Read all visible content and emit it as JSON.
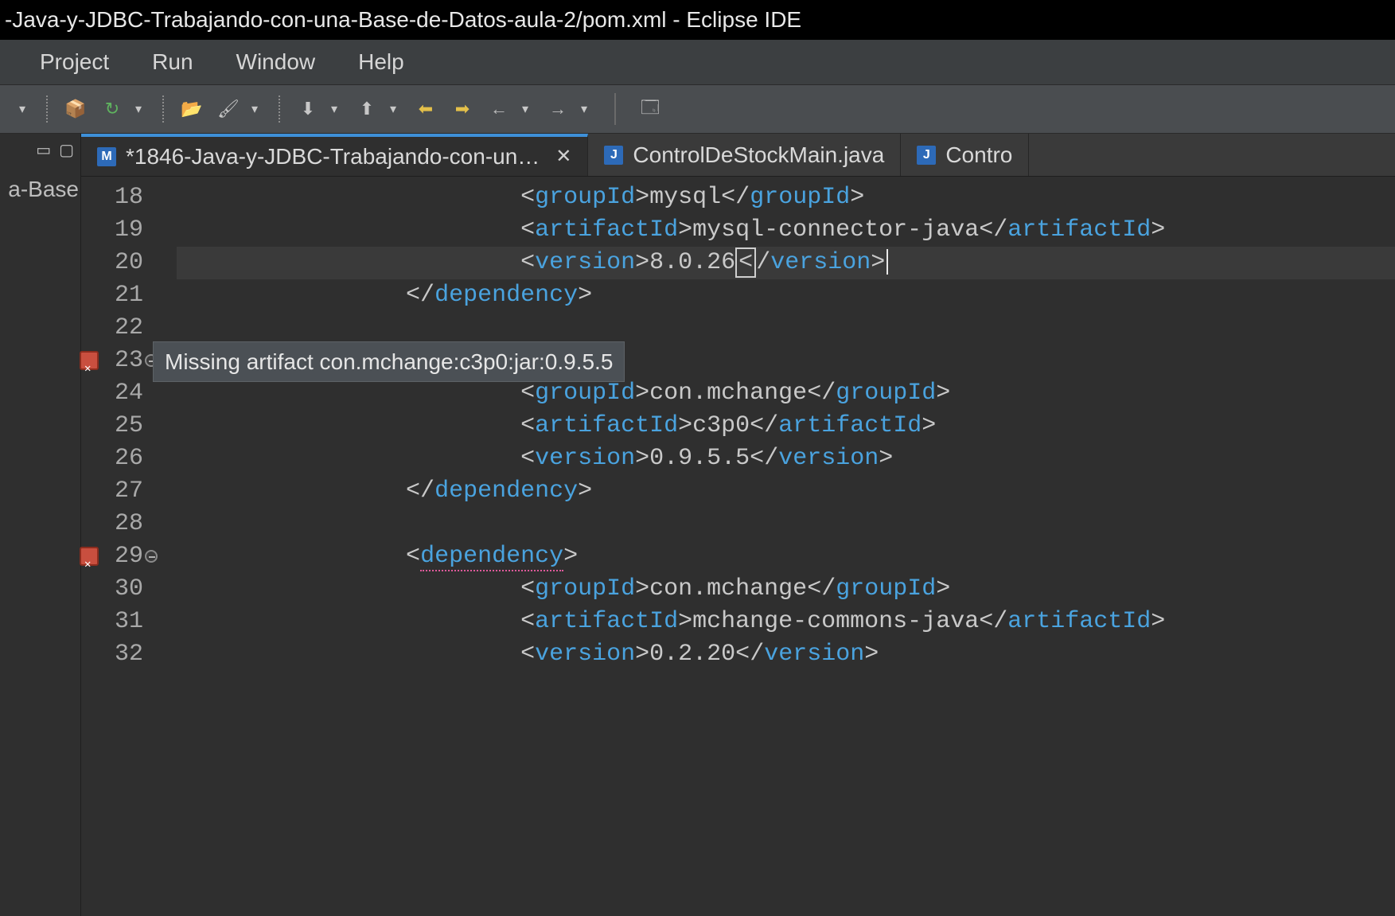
{
  "window": {
    "title": "-Java-y-JDBC-Trabajando-con-una-Base-de-Datos-aula-2/pom.xml - Eclipse IDE"
  },
  "menu": {
    "items": [
      "Project",
      "Run",
      "Window",
      "Help"
    ]
  },
  "sidebar": {
    "tree_peek": "a-Base"
  },
  "tabs": [
    {
      "icon": "M",
      "label": "*1846-Java-y-JDBC-Trabajando-con-un…",
      "active": true,
      "closable": true
    },
    {
      "icon": "J",
      "label": "ControlDeStockMain.java",
      "active": false,
      "closable": false
    },
    {
      "icon": "J",
      "label": "Contro",
      "active": false,
      "closable": false
    }
  ],
  "editor": {
    "tooltip": "Missing artifact con.mchange:c3p0:jar:0.9.5.5",
    "tooltip_line_index": 5,
    "lines": [
      {
        "n": 18,
        "indent": 3,
        "type": "tag",
        "tag": "groupId",
        "text": "mysql"
      },
      {
        "n": 19,
        "indent": 3,
        "type": "tag",
        "tag": "artifactId",
        "text": "mysql-connector-java"
      },
      {
        "n": 20,
        "indent": 3,
        "type": "tag",
        "tag": "version",
        "text": "8.0.26",
        "current": true,
        "bracket": true,
        "caret": true
      },
      {
        "n": 21,
        "indent": 2,
        "type": "close",
        "tag": "dependency"
      },
      {
        "n": 22,
        "indent": 0,
        "type": "blank"
      },
      {
        "n": 23,
        "indent": 0,
        "type": "blank",
        "error": true,
        "fold": true
      },
      {
        "n": 24,
        "indent": 3,
        "type": "tag",
        "tag": "groupId",
        "text": "con.mchange"
      },
      {
        "n": 25,
        "indent": 3,
        "type": "tag",
        "tag": "artifactId",
        "text": "c3p0"
      },
      {
        "n": 26,
        "indent": 3,
        "type": "tag",
        "tag": "version",
        "text": "0.9.5.5"
      },
      {
        "n": 27,
        "indent": 2,
        "type": "close",
        "tag": "dependency"
      },
      {
        "n": 28,
        "indent": 0,
        "type": "blank"
      },
      {
        "n": 29,
        "indent": 2,
        "type": "open",
        "tag": "dependency",
        "error": true,
        "fold": true,
        "underline": true
      },
      {
        "n": 30,
        "indent": 3,
        "type": "tag",
        "tag": "groupId",
        "text": "con.mchange"
      },
      {
        "n": 31,
        "indent": 3,
        "type": "tag",
        "tag": "artifactId",
        "text": "mchange-commons-java"
      },
      {
        "n": 32,
        "indent": 3,
        "type": "tag",
        "tag": "version",
        "text": "0.2.20"
      }
    ]
  },
  "toolbar_icons": [
    "dropdown",
    "sep",
    "new-package",
    "refresh",
    "dropdown",
    "sep",
    "open",
    "brush",
    "dropdown",
    "sep",
    "step-down",
    "dropdown",
    "step-up",
    "dropdown",
    "back-yel",
    "fwd-yel",
    "back",
    "dropdown",
    "fwd",
    "dropdown",
    "pipe",
    "window-new"
  ]
}
